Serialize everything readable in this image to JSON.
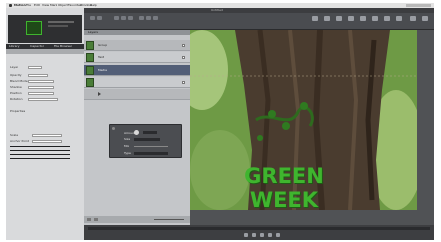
{
  "menubar": {
    "app_name": "Motion",
    "items": [
      "File",
      "Edit",
      "View",
      "Mark",
      "Object",
      "Favorites",
      "Window",
      "Help"
    ]
  },
  "window": {
    "title": "Untitled"
  },
  "inspector": {
    "tabs": [
      "Library",
      "Inspector",
      "File Browser"
    ],
    "fields": [
      "Layer",
      "Opacity",
      "Blend Mode",
      "Shadow",
      "Position",
      "Rotation",
      "Scale",
      "Anchor Point"
    ],
    "section_label": "Properties"
  },
  "layers": {
    "header": "Layers",
    "rows": [
      {
        "label": "Group"
      },
      {
        "label": "Text"
      },
      {
        "label": "Media"
      }
    ]
  },
  "dialog": {
    "fields": [
      "Amount",
      "Size",
      "Mix",
      "Type"
    ]
  },
  "viewer": {
    "overlay_text_line1": "GREEN",
    "overlay_text_line2": "WEEK"
  },
  "colors": {
    "overlay_text": "#3fb52e",
    "overlay_text_shadow": "#1d5c14",
    "app_bg": "#505255"
  }
}
